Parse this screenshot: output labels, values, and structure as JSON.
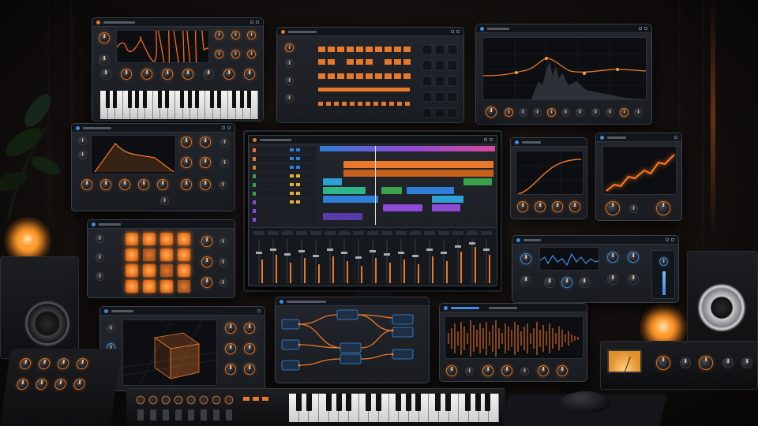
{
  "scene": {
    "description_tags": [
      "studio",
      "plugins",
      "daw"
    ],
    "accent": "#e8782a",
    "accent_secondary": "#3e8de0",
    "background": "#0b0908"
  },
  "panels": {
    "synth": {
      "icon": "synth-icon"
    },
    "step_sequencer": {
      "icon": "sequencer-icon"
    },
    "eq": {
      "icon": "eq-icon"
    },
    "envelope": {
      "icon": "envelope-icon"
    },
    "daw": {
      "icon": "daw-icon"
    },
    "compressor_a": {
      "icon": "curve-icon"
    },
    "compressor_b": {
      "icon": "curve-icon"
    },
    "drum_pads": {
      "icon": "pads-icon",
      "pad_count": 16
    },
    "spectrum": {
      "icon": "spectrum-icon"
    },
    "visualizer_3d": {
      "icon": "cube-icon"
    },
    "node_graph": {
      "icon": "graph-icon"
    },
    "waveform": {
      "icon": "waveform-icon"
    }
  }
}
